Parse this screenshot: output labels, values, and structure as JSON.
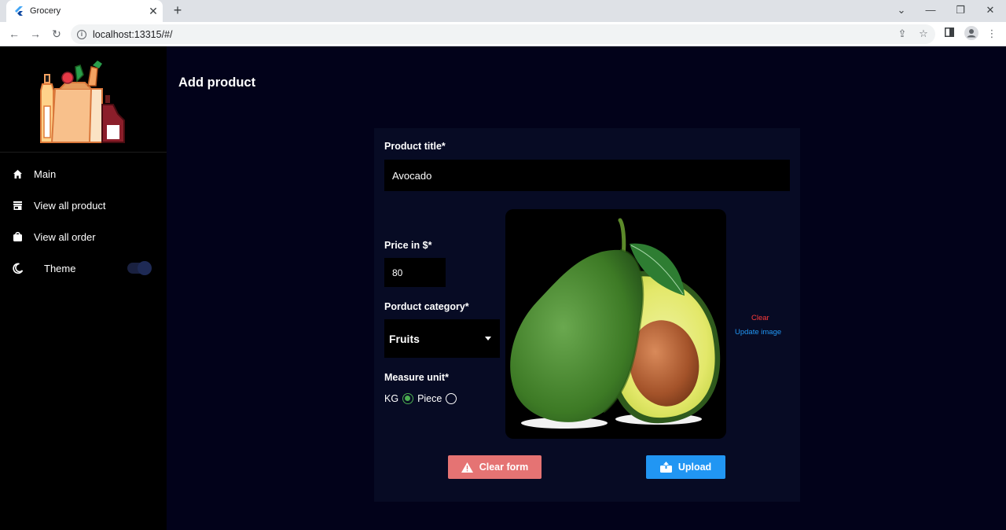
{
  "browser": {
    "tab_title": "Grocery",
    "url": "localhost:13315/#/"
  },
  "sidebar": {
    "items": [
      {
        "label": "Main",
        "icon": "home-icon"
      },
      {
        "label": "View all product",
        "icon": "store-icon"
      },
      {
        "label": "View all order",
        "icon": "shopping-bag-icon"
      }
    ],
    "theme_label": "Theme"
  },
  "page": {
    "title": "Add product"
  },
  "form": {
    "title_label": "Product title*",
    "title_value": "Avocado",
    "price_label": "Price in $*",
    "price_value": "80",
    "category_label": "Porduct category*",
    "category_value": "Fruits",
    "measure_label": "Measure unit*",
    "measure_options": [
      "KG",
      "Piece"
    ],
    "measure_selected": "KG",
    "clear_link": "Clear",
    "update_image_link": "Update image",
    "clear_form_button": "Clear form",
    "upload_button": "Upload"
  },
  "colors": {
    "background": "#02021a",
    "card": "#070b24",
    "clear_button": "#e57373",
    "upload_button": "#2196f3",
    "radio_selected": "#4caf50",
    "link_clear": "#ff3b3b",
    "link_update": "#2196f3"
  }
}
